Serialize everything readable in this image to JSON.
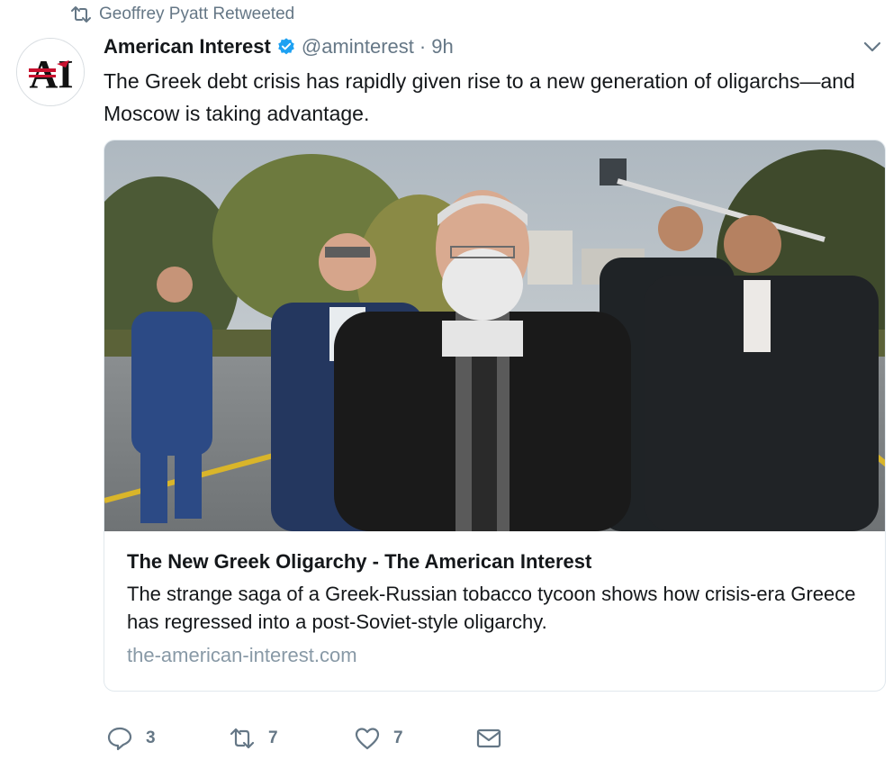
{
  "context": {
    "retweeted_by": "Geoffrey Pyatt Retweeted",
    "icon": "retweet-icon"
  },
  "tweet": {
    "display_name": "American Interest",
    "verified": true,
    "handle": "@aminterest",
    "separator": "·",
    "time": "9h",
    "text": "The Greek debt crisis has rapidly given rise to a new generation of oligarchs—and Moscow is taking advantage.",
    "avatar_letters": "AI"
  },
  "card": {
    "title": "The New Greek Oligarchy - The American Interest",
    "description": "The strange saga of a Greek-Russian tobacco tycoon shows how crisis-era Greece has regressed into a post-Soviet-style oligarchy.",
    "domain": "the-american-interest.com",
    "image_icon": "photo-of-men-walking-on-street"
  },
  "actions": {
    "reply_count": "3",
    "retweet_count": "7",
    "like_count": "7"
  },
  "colors": {
    "link_gray": "#657786",
    "verified_blue": "#1da1f2",
    "avatar_red": "#c8102e"
  }
}
